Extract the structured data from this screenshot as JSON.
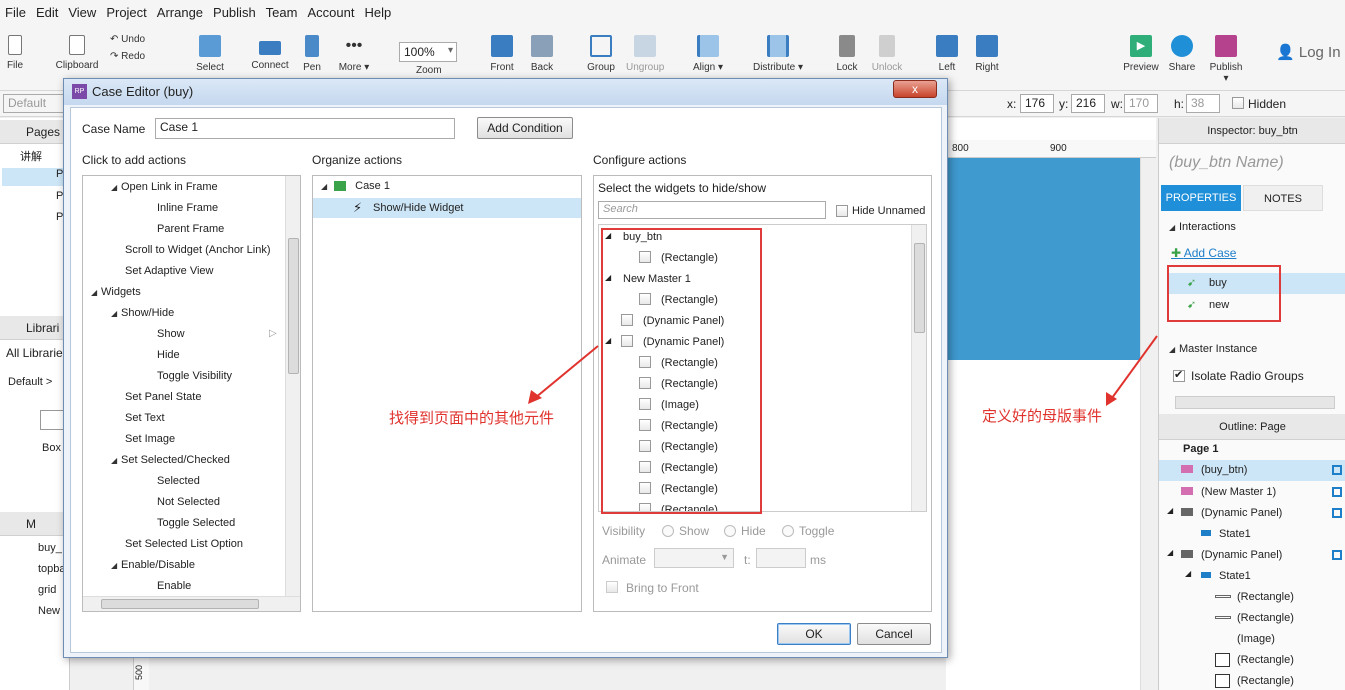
{
  "menu": [
    "File",
    "Edit",
    "View",
    "Project",
    "Arrange",
    "Publish",
    "Team",
    "Account",
    "Help"
  ],
  "toolbar": {
    "file": "File",
    "clipboard": "Clipboard",
    "undo": "Undo",
    "redo": "Redo",
    "select": "Select",
    "connect": "Connect",
    "pen": "Pen",
    "more": "More ▾",
    "zoom_value": "100%",
    "zoom": "Zoom",
    "front": "Front",
    "back": "Back",
    "group": "Group",
    "ungroup": "Ungroup",
    "align": "Align ▾",
    "distribute": "Distribute ▾",
    "lock": "Lock",
    "unlock": "Unlock",
    "left": "Left",
    "right": "Right",
    "preview": "Preview",
    "share": "Share",
    "publish": "Publish ▾",
    "login": "Log In"
  },
  "stylebar": {
    "style": "Default",
    "x_label": "x:",
    "x": "176",
    "y_label": "y:",
    "y": "216",
    "w_label": "w:",
    "w": "170",
    "h_label": "h:",
    "h": "38",
    "hidden": "Hidden"
  },
  "left": {
    "pages": "Pages",
    "page_root": "讲解",
    "page_items": [
      "P",
      "P",
      "P"
    ],
    "libraries": "Librari",
    "all_libraries": "All Librarie",
    "default": "Default >",
    "box": "Box",
    "masters": "M",
    "master_items": [
      "buy_",
      "topba",
      "grid",
      "New"
    ]
  },
  "canvas": {
    "ruler_800": "800",
    "ruler_900": "900",
    "vruler_500": "500"
  },
  "inspector": {
    "title": "Inspector: buy_btn",
    "name_placeholder": "(buy_btn Name)",
    "tab_properties": "PROPERTIES",
    "tab_notes": "NOTES",
    "interactions": "Interactions",
    "add_case": "Add Case",
    "cases": [
      "buy",
      "new"
    ],
    "master_instance": "Master Instance",
    "isolate": "Isolate Radio Groups",
    "outline": "Outline: Page",
    "outline_page": "Page 1",
    "outline_items": [
      "(buy_btn)",
      "(New Master 1)",
      "(Dynamic Panel)",
      "State1",
      "(Dynamic Panel)",
      "State1",
      "(Rectangle)",
      "(Rectangle)",
      "(Image)",
      "(Rectangle)",
      "(Rectangle)"
    ]
  },
  "dialog": {
    "title": "Case Editor (buy)",
    "logo": "RP",
    "close": "x",
    "case_name_label": "Case Name",
    "case_name_value": "Case 1",
    "add_condition": "Add Condition",
    "col1": "Click to add actions",
    "col2": "Organize actions",
    "col3": "Configure actions",
    "actions": [
      {
        "t": "Open Link in Frame",
        "lvl": 2,
        "tri": true
      },
      {
        "t": "Inline Frame",
        "lvl": 3
      },
      {
        "t": "Parent Frame",
        "lvl": 3
      },
      {
        "t": "Scroll to Widget (Anchor Link)",
        "lvl": 2
      },
      {
        "t": "Set Adaptive View",
        "lvl": 2
      },
      {
        "t": "Widgets",
        "lvl": 1,
        "tri": true
      },
      {
        "t": "Show/Hide",
        "lvl": 2,
        "tri": true
      },
      {
        "t": "Show",
        "lvl": 3
      },
      {
        "t": "Hide",
        "lvl": 3
      },
      {
        "t": "Toggle Visibility",
        "lvl": 3
      },
      {
        "t": "Set Panel State",
        "lvl": 2
      },
      {
        "t": "Set Text",
        "lvl": 2
      },
      {
        "t": "Set Image",
        "lvl": 2
      },
      {
        "t": "Set Selected/Checked",
        "lvl": 2,
        "tri": true
      },
      {
        "t": "Selected",
        "lvl": 3
      },
      {
        "t": "Not Selected",
        "lvl": 3
      },
      {
        "t": "Toggle Selected",
        "lvl": 3
      },
      {
        "t": "Set Selected List Option",
        "lvl": 2
      },
      {
        "t": "Enable/Disable",
        "lvl": 2,
        "tri": true
      },
      {
        "t": "Enable",
        "lvl": 3
      }
    ],
    "organize": {
      "case": "Case 1",
      "action": "Show/Hide Widget"
    },
    "configure": {
      "select_label": "Select the widgets to hide/show",
      "search_placeholder": "Search",
      "hide_unnamed": "Hide Unnamed",
      "widgets": [
        {
          "t": "buy_btn",
          "lvl": 0,
          "tri": true,
          "cb": false
        },
        {
          "t": "(Rectangle)",
          "lvl": 1,
          "cb": true
        },
        {
          "t": "New Master 1",
          "lvl": 0,
          "tri": true,
          "cb": false
        },
        {
          "t": "(Rectangle)",
          "lvl": 1,
          "cb": true
        },
        {
          "t": "(Dynamic Panel)",
          "lvl": 0,
          "cb": true
        },
        {
          "t": "(Dynamic Panel)",
          "lvl": 0,
          "tri": true,
          "cb": true
        },
        {
          "t": "(Rectangle)",
          "lvl": 1,
          "cb": true
        },
        {
          "t": "(Rectangle)",
          "lvl": 1,
          "cb": true
        },
        {
          "t": "(Image)",
          "lvl": 1,
          "cb": true
        },
        {
          "t": "(Rectangle)",
          "lvl": 1,
          "cb": true
        },
        {
          "t": "(Rectangle)",
          "lvl": 1,
          "cb": true
        },
        {
          "t": "(Rectangle)",
          "lvl": 1,
          "cb": true
        },
        {
          "t": "(Rectangle)",
          "lvl": 1,
          "cb": true
        },
        {
          "t": "(Rectangle)",
          "lvl": 1,
          "cb": true
        }
      ],
      "visibility": "Visibility",
      "show": "Show",
      "hide": "Hide",
      "toggle": "Toggle",
      "animate": "Animate",
      "t_label": "t:",
      "ms": "ms",
      "bring_to_front": "Bring to Front"
    },
    "ok": "OK",
    "cancel": "Cancel"
  },
  "annotations": {
    "left_note": "找得到页面中的其他元件",
    "right_note": "定义好的母版事件",
    "color": "#e0332e"
  }
}
